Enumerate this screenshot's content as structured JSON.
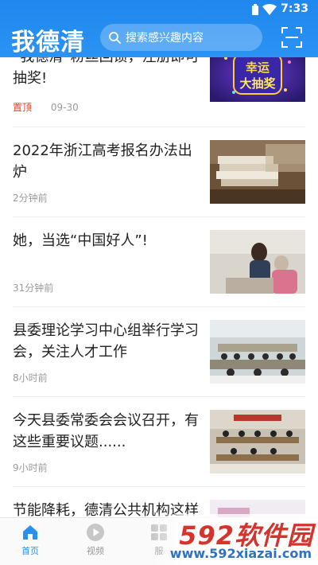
{
  "status_bar": {
    "time": "7:33"
  },
  "header": {
    "logo": "我德清",
    "search_placeholder": "搜索感兴趣内容"
  },
  "feed": [
    {
      "title": "“我德清”粉丝回馈，注册即可抽奖!",
      "pinned": "置顶",
      "time": "09-30",
      "thumb_text": "幸运\n大抽奖"
    },
    {
      "title": "2022年浙江高考报名办法出炉",
      "time": "2分钟前"
    },
    {
      "title": "她，当选“中国好人”!",
      "time": "31分钟前"
    },
    {
      "title": "县委理论学习中心组举行学习会，关注人才工作",
      "time": "8小时前"
    },
    {
      "title": "今天县委常委会会议召开，有这些重要议题......",
      "time": "9小时前"
    },
    {
      "title": "节能降耗，德清公共机构这样",
      "time": ""
    }
  ],
  "bottom_nav": [
    {
      "label": "首页",
      "active": true
    },
    {
      "label": "视频",
      "active": false
    },
    {
      "label": "服",
      "active": false
    }
  ],
  "watermark": {
    "main": "592软件园",
    "url": "www.592xiazai.com"
  },
  "colors": {
    "header_blue": "#2a8ff1",
    "pin_red": "#e0402c",
    "meta_gray": "#9a9a9a"
  }
}
